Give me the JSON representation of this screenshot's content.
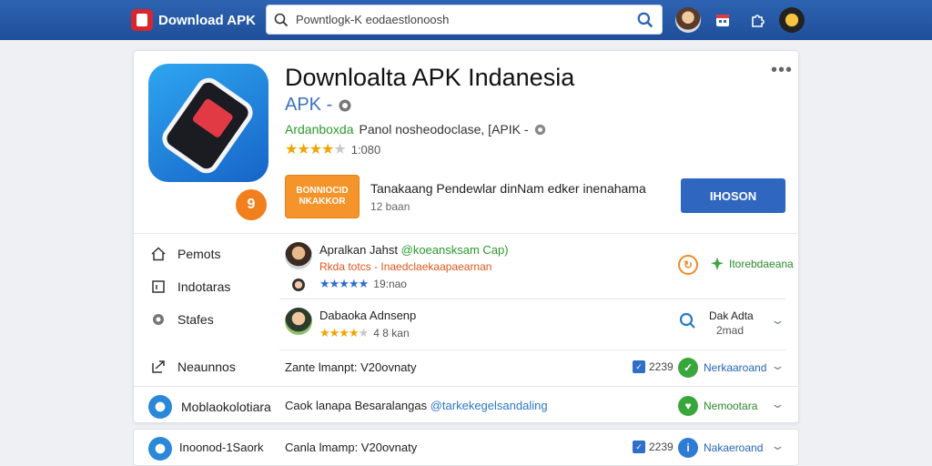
{
  "topbar": {
    "brand": "Download APK",
    "search_value": "Powntlogk-K eodaestlonoosh"
  },
  "app": {
    "title": "Downloalta APK Indanesia",
    "type": "APK -",
    "developer": "Ardanboxda",
    "developer_sub": "Panol nosheodoclase, [APIK -",
    "rating_count": "1:080",
    "install_label": "BONNIOCID NKAKKOR",
    "badge": "9",
    "description": "Tanakaang Pendewlar dinNam edker inenahama",
    "description_sub": "12 baan",
    "primary_button": "IHOSON"
  },
  "nav": [
    {
      "label": "Pemots",
      "icon": "home-icon"
    },
    {
      "label": "Indotaras",
      "icon": "bracket-icon"
    },
    {
      "label": "Stafes",
      "icon": "dot-icon"
    },
    {
      "label": "Neaunnos",
      "icon": "share-icon"
    },
    {
      "label": "Moblaokolotiara",
      "icon": "app-icon"
    }
  ],
  "reviews": [
    {
      "name": "Apralkan Jahst",
      "tag": "@koeansksam Cap)",
      "line": "Rkda totcs - Inaedclaekaapaearnan",
      "sub": "19:nao",
      "action": "Itorebdaeana"
    },
    {
      "name": "Dabaoka Adnsenp",
      "sub": "4 8 kan",
      "action": "Dak Adta",
      "action_sub": "2mad"
    }
  ],
  "rows": [
    {
      "text": "Zante lmanpt: V20ovnaty",
      "count": "2239",
      "action": "Nerkaaroand"
    },
    {
      "text": "Caok lanapa Besaralangas",
      "highlight": "@tarkekegelsandaling",
      "action": "Nemootara"
    }
  ],
  "card2": {
    "name": "Inoonod-1Saork",
    "text": "Canla lmamp: V20ovnaty",
    "count": "2239",
    "action": "Nakaeroand"
  },
  "colors": {
    "topbar": "#2d63b2",
    "accent_orange": "#f4942a",
    "primary_blue": "#2f67c0",
    "star": "#f0a500",
    "green": "#2a9a2a"
  }
}
